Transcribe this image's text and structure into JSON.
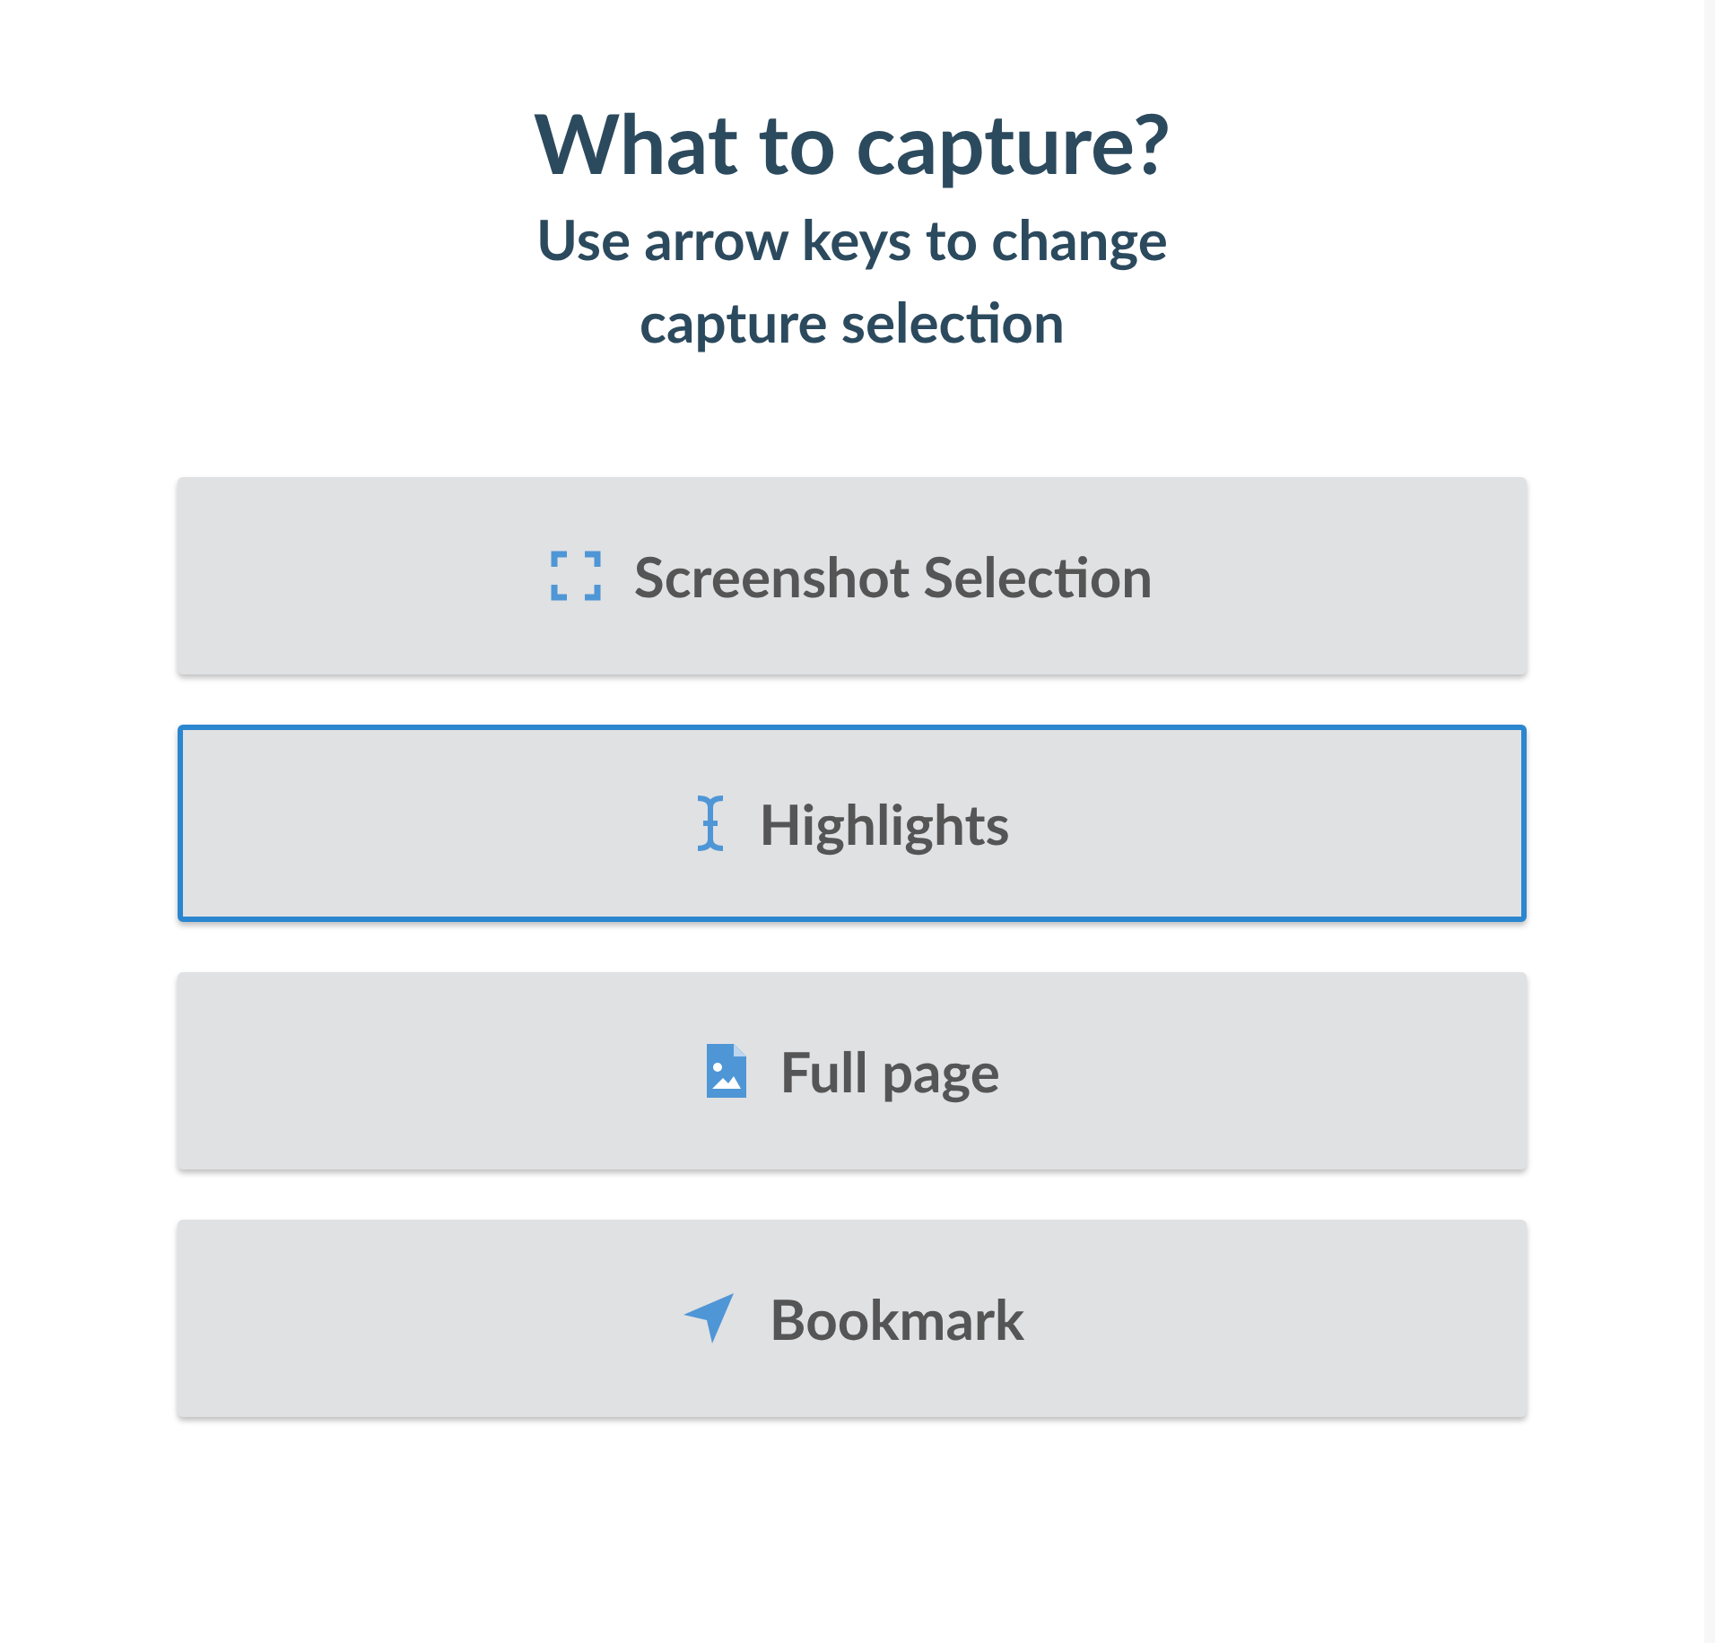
{
  "title": "What to capture?",
  "subtitle": "Use arrow keys to change capture selection",
  "options": [
    {
      "kind": "selection",
      "label": "Screenshot Selection",
      "selected": false
    },
    {
      "kind": "cursor",
      "label": "Highlights",
      "selected": true
    },
    {
      "kind": "image",
      "label": "Full page",
      "selected": false
    },
    {
      "kind": "arrow",
      "label": "Bookmark",
      "selected": false
    }
  ]
}
